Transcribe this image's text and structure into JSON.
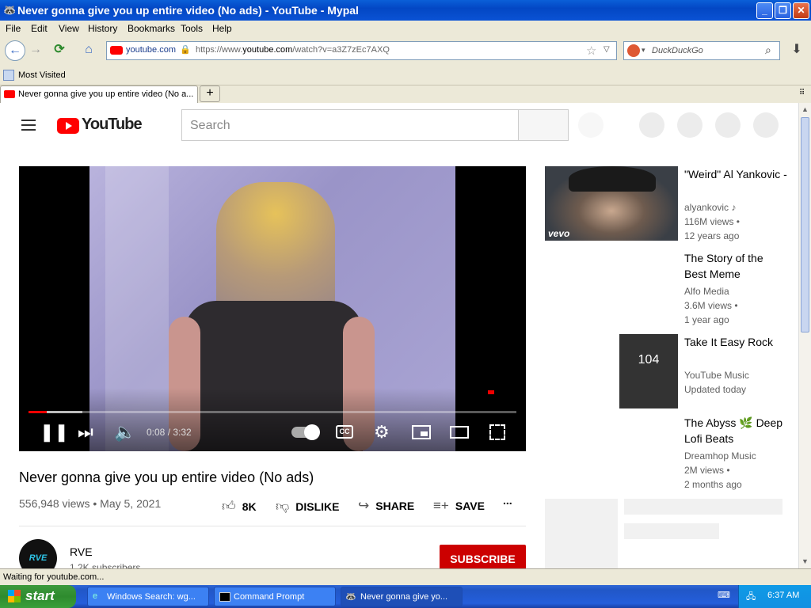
{
  "window": {
    "title": "Never gonna give you up entire video (No ads) - YouTube - Mypal"
  },
  "menu": [
    "File",
    "Edit",
    "View",
    "History",
    "Bookmarks",
    "Tools",
    "Help"
  ],
  "nav": {
    "site_badge": "youtube.com",
    "url_prefix": "https://www.",
    "url_domain": "youtube.com",
    "url_suffix": "/watch?v=a3Z7zEc7AXQ",
    "search_placeholder": "DuckDuckGo"
  },
  "bookmarks": {
    "most_visited": "Most Visited"
  },
  "tab": {
    "label": "Never gonna give you up entire video (No a...",
    "new_tab": "+"
  },
  "youtube": {
    "logo_text": "YouTube",
    "search_placeholder": "Search",
    "player": {
      "time": "0:08 / 3:32",
      "progress": 0.038,
      "buffered": 0.11
    },
    "video": {
      "title": "Never gonna give you up entire video (No ads)",
      "meta": "556,948 views • May 5, 2021",
      "likes": "8K",
      "dislike": "DISLIKE",
      "share": "SHARE",
      "save": "SAVE",
      "more": "..."
    },
    "channel": {
      "avatar_text": "RVE",
      "name": "RVE",
      "subs": "1.2K subscribers",
      "subscribe": "SUBSCRIBE"
    },
    "related": [
      {
        "title": "\"Weird\" Al Yankovic -",
        "channel": "alyankovic ♪",
        "views": "116M views •",
        "age": "12 years ago",
        "badge": "vevo"
      },
      {
        "title": "The Story of the Best Meme",
        "channel": "Alfo Media",
        "views": "3.6M views •",
        "age": "1 year ago"
      },
      {
        "title": "Take It Easy Rock",
        "channel": "YouTube Music",
        "age": "Updated today",
        "count": "104"
      },
      {
        "title": "The Abyss 🌿 Deep Lofi Beats",
        "channel": "Dreamhop Music",
        "views": "2M views •",
        "age": "2 months ago"
      }
    ]
  },
  "status": {
    "text": "Waiting for youtube.com..."
  },
  "taskbar": {
    "start": "start",
    "tasks": [
      "Windows Search: wg...",
      "Command Prompt",
      "Never gonna give yo..."
    ],
    "clock": "6:37 AM"
  },
  "colors": {
    "yt_red": "#ff0000",
    "subscribe_red": "#cc0000",
    "xp_blue": "#245edb"
  }
}
